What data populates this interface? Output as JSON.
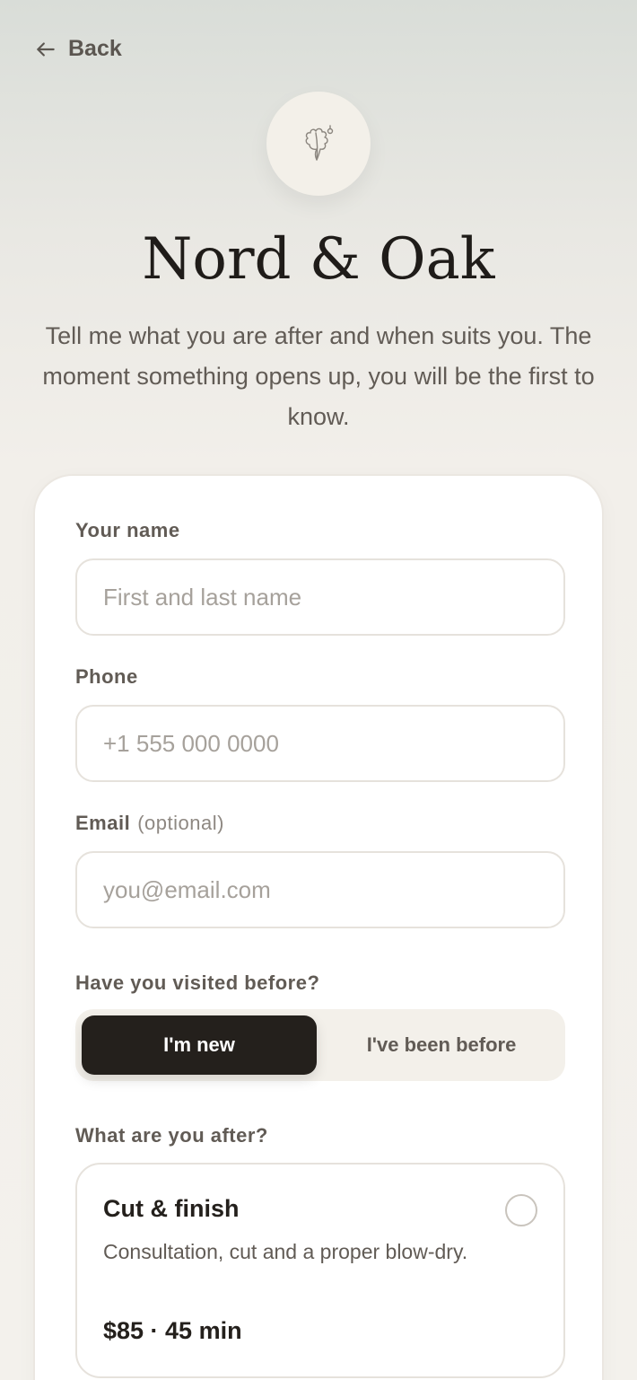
{
  "nav": {
    "back_label": "Back"
  },
  "brand": {
    "name": "Nord & Oak"
  },
  "intro": "Tell me what you are after and when suits you. The moment something opens up, you will be the first to know.",
  "form": {
    "name": {
      "label": "Your name",
      "placeholder": "First and last name",
      "value": ""
    },
    "phone": {
      "label": "Phone",
      "placeholder": "+1 555 000 0000",
      "value": ""
    },
    "email": {
      "label": "Email",
      "optional": "(optional)",
      "placeholder": "you@email.com",
      "value": ""
    },
    "visited": {
      "label": "Have you visited before?",
      "options": [
        "I'm new",
        "I've been before"
      ],
      "selected": "I'm new"
    },
    "service": {
      "label": "What are you after?",
      "items": [
        {
          "title": "Cut & finish",
          "description": "Consultation, cut and a proper blow-dry.",
          "price": "$85 · 45 min",
          "selected": false
        }
      ]
    }
  },
  "colors": {
    "accent": "#24201c",
    "background": "#f3f1ec",
    "muted_text": "#615b55"
  },
  "icons": {
    "back": "arrow-left-icon",
    "logo": "oak-leaf-icon",
    "radio": "radio-unchecked-icon"
  }
}
